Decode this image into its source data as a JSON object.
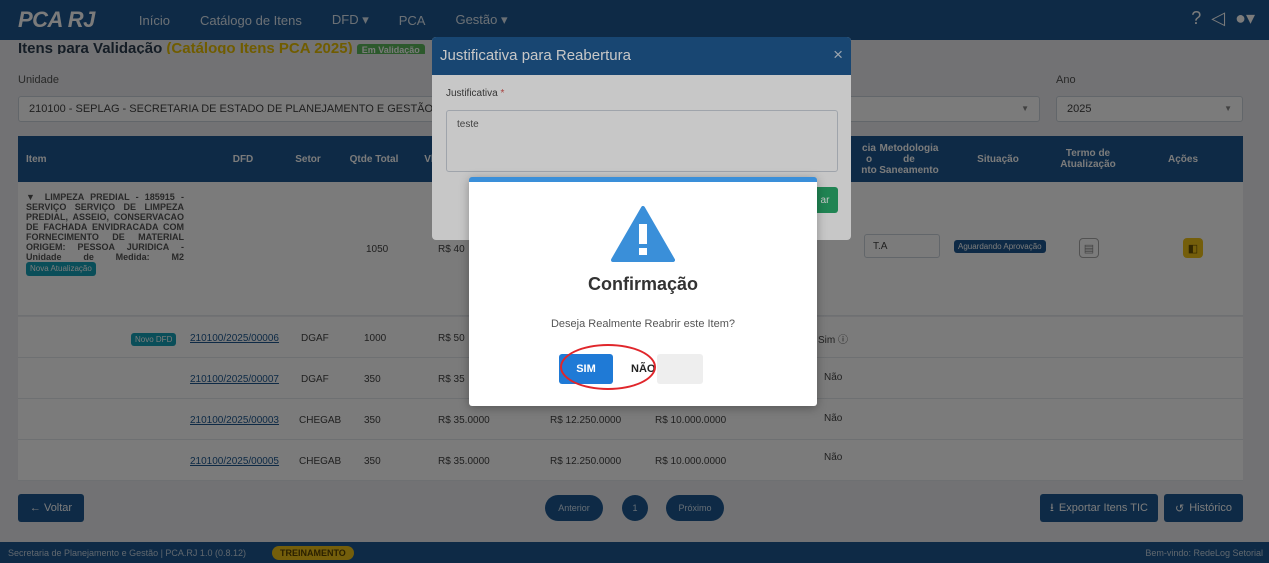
{
  "navbar": {
    "brand": "PCA RJ",
    "items": [
      "Início",
      "Catálogo de Itens",
      "DFD ▾",
      "PCA",
      "Gestão ▾"
    ],
    "icons": [
      "help-icon",
      "megaphone-icon",
      "user-icon"
    ]
  },
  "header": {
    "title": "Itens para Validação",
    "title_highlight": "(Catálogo Itens PCA 2025)",
    "title_badge": "Em Validação",
    "unidade_label": "Unidade",
    "unidade_value": "210100 - SEPLAG - SECRETARIA DE ESTADO DE PLANEJAMENTO E GESTÃO",
    "ano_label": "Ano",
    "ano_value": "2025"
  },
  "table": {
    "columns": [
      "Item",
      "DFD",
      "Setor",
      "Qtde Total",
      "Vl",
      "cia\no\nnto",
      "Metodologia\nde\nSaneamento",
      "Situação",
      "Termo de\nAtualização",
      "Ações"
    ],
    "main_item": {
      "description": "▼ LIMPEZA PREDIAL - 185915 - SERVIÇO SERVIÇO DE LIMPEZA PREDIAL, ASSEIO, CONSERVACAO DE FACHADA ENVIDRACADA COM FORNECIMENTO DE MATERIAL ORIGEM: PESSOA JURIDICA - Unidade de Medida: M2",
      "badge": "Nova Atualização",
      "qtde": "1050",
      "valor": "R$ 40",
      "metodologia": "T.A",
      "situacao": "Aguardando Aprovação"
    },
    "rows": [
      {
        "badge": "Novo DFD",
        "dfd": "210100/2025/00006",
        "setor": "DGAF",
        "qtde": "1000",
        "vl": "R$ 50",
        "v2": "",
        "v3": "",
        "flag": "Sim ⓘ"
      },
      {
        "badge": "",
        "dfd": "210100/2025/00007",
        "setor": "DGAF",
        "qtde": "350",
        "vl": "R$ 35",
        "v2": "",
        "v3": "",
        "flag": "Não"
      },
      {
        "badge": "",
        "dfd": "210100/2025/00003",
        "setor": "CHEGAB",
        "qtde": "350",
        "vl": "R$ 35.0000",
        "v2": "R$ 12.250.0000",
        "v3": "R$ 10.000.0000",
        "flag": "Não"
      },
      {
        "badge": "",
        "dfd": "210100/2025/00005",
        "setor": "CHEGAB",
        "qtde": "350",
        "vl": "R$ 35.0000",
        "v2": "R$ 12.250.0000",
        "v3": "R$ 10.000.0000",
        "flag": "Não"
      }
    ]
  },
  "actions": {
    "back": "← Voltar",
    "prev": "Anterior",
    "page": "1",
    "next": "Próximo",
    "export": "Exportar Itens TIC",
    "history": "Histórico"
  },
  "footer": {
    "left": "Secretaria de Planejamento e Gestão | PCA.RJ 1.0 (0.8.12)",
    "badge": "TREINAMENTO",
    "right": "Bem-vindo: RedeLog Setorial"
  },
  "modal_reopen": {
    "title": "Justificativa para Reabertura",
    "close": "×",
    "label": "Justificativa",
    "required": "*",
    "value": "teste",
    "button": "ar"
  },
  "confirm_dialog": {
    "title": "Confirmação",
    "message": "Deseja Realmente Reabrir este Item?",
    "yes": "SIM",
    "no": "NÃO"
  },
  "colors": {
    "primary": "#1f5a92",
    "accent_blue": "#1f7ad6",
    "success": "#2aa96b",
    "warning": "#f0c419",
    "highlight_ring": "#e0262b"
  }
}
